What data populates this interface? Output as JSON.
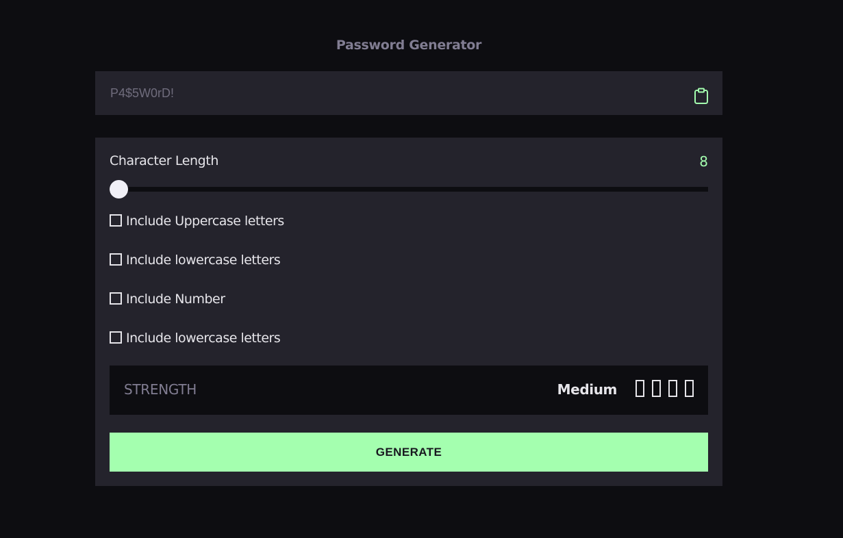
{
  "app": {
    "title": "Password Generator"
  },
  "password": {
    "placeholder": "P4$5W0rD!",
    "value": "",
    "copy_icon": "clipboard-icon"
  },
  "length": {
    "label": "Character Length",
    "value": "8",
    "slider_level": 0
  },
  "options": [
    {
      "label": "Include Uppercase letters",
      "checked": false
    },
    {
      "label": "Include lowercase letters",
      "checked": false
    },
    {
      "label": "Include Number",
      "checked": false
    },
    {
      "label": "Include lowercase letters",
      "checked": false
    }
  ],
  "strength": {
    "label": "STRENGTH",
    "value": "Medium",
    "bars_total": 4,
    "bars_filled": 0
  },
  "generate": {
    "label": "GENERATE"
  },
  "colors": {
    "background": "#0d0d11",
    "panel": "#24232c",
    "accent": "#a4ffaf",
    "muted_text": "#817d92",
    "text": "#e6e5ea"
  }
}
